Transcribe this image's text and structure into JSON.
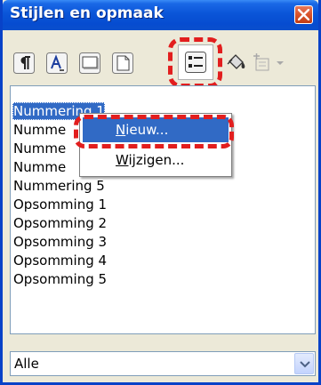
{
  "window": {
    "title": "Stijlen en opmaak"
  },
  "toolbar": {
    "buttons": [
      {
        "icon": "paragraph-styles-icon"
      },
      {
        "icon": "character-styles-icon"
      },
      {
        "icon": "frame-styles-icon"
      },
      {
        "icon": "page-styles-icon"
      },
      {
        "icon": "list-styles-icon",
        "active": true
      },
      {
        "icon": "fill-format-mode-icon"
      },
      {
        "icon": "new-style-from-selection-icon"
      }
    ]
  },
  "style_list": {
    "items": [
      "Nummering 1",
      "Numme",
      "Numme",
      "Numme",
      "Nummering 5",
      "Opsomming 1",
      "Opsomming 2",
      "Opsomming 3",
      "Opsomming 4",
      "Opsomming 5"
    ],
    "selected": "Nummering 1"
  },
  "context_menu": {
    "new": {
      "underline": "N",
      "rest": "ieuw..."
    },
    "edit": {
      "underline": "W",
      "rest": "ijzigen..."
    }
  },
  "filter": {
    "value": "Alle"
  },
  "colors": {
    "titlebar": "#0a55d8",
    "selection": "#316ac5",
    "annotation": "#e21e1e"
  }
}
